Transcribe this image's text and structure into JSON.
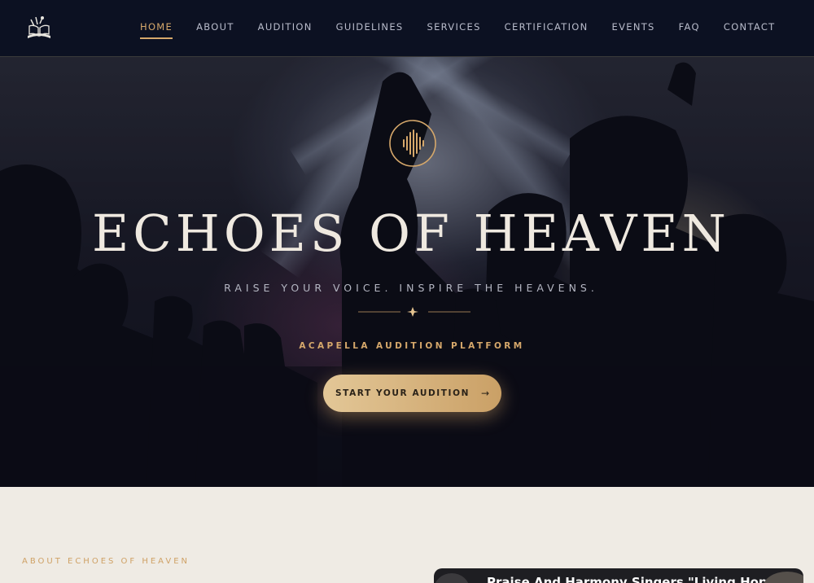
{
  "nav": {
    "logo_icon": "choir-book-logo-icon",
    "items": [
      {
        "label": "HOME",
        "active": true
      },
      {
        "label": "ABOUT",
        "active": false
      },
      {
        "label": "AUDITION",
        "active": false
      },
      {
        "label": "GUIDELINES",
        "active": false
      },
      {
        "label": "SERVICES",
        "active": false
      },
      {
        "label": "CERTIFICATION",
        "active": false
      },
      {
        "label": "EVENTS",
        "active": false
      },
      {
        "label": "FAQ",
        "active": false
      },
      {
        "label": "CONTACT",
        "active": false
      }
    ]
  },
  "hero": {
    "emblem_icon": "soundwave-emblem-icon",
    "title": "ECHOES OF HEAVEN",
    "tagline": "RAISE YOUR VOICE. INSPIRE THE HEAVENS.",
    "divider_icon": "sparkle-icon",
    "subtitle": "ACAPELLA AUDITION PLATFORM",
    "cta_label": "START YOUR AUDITION",
    "cta_icon": "arrow-right-icon"
  },
  "about": {
    "eyebrow": "ABOUT ECHOES OF HEAVEN",
    "video_title": "Praise And Harmony Singers \"Living Hope\" fro"
  },
  "colors": {
    "accent": "#d6a86b",
    "nav_bg": "#0c1122",
    "section_bg": "#efebe4"
  }
}
